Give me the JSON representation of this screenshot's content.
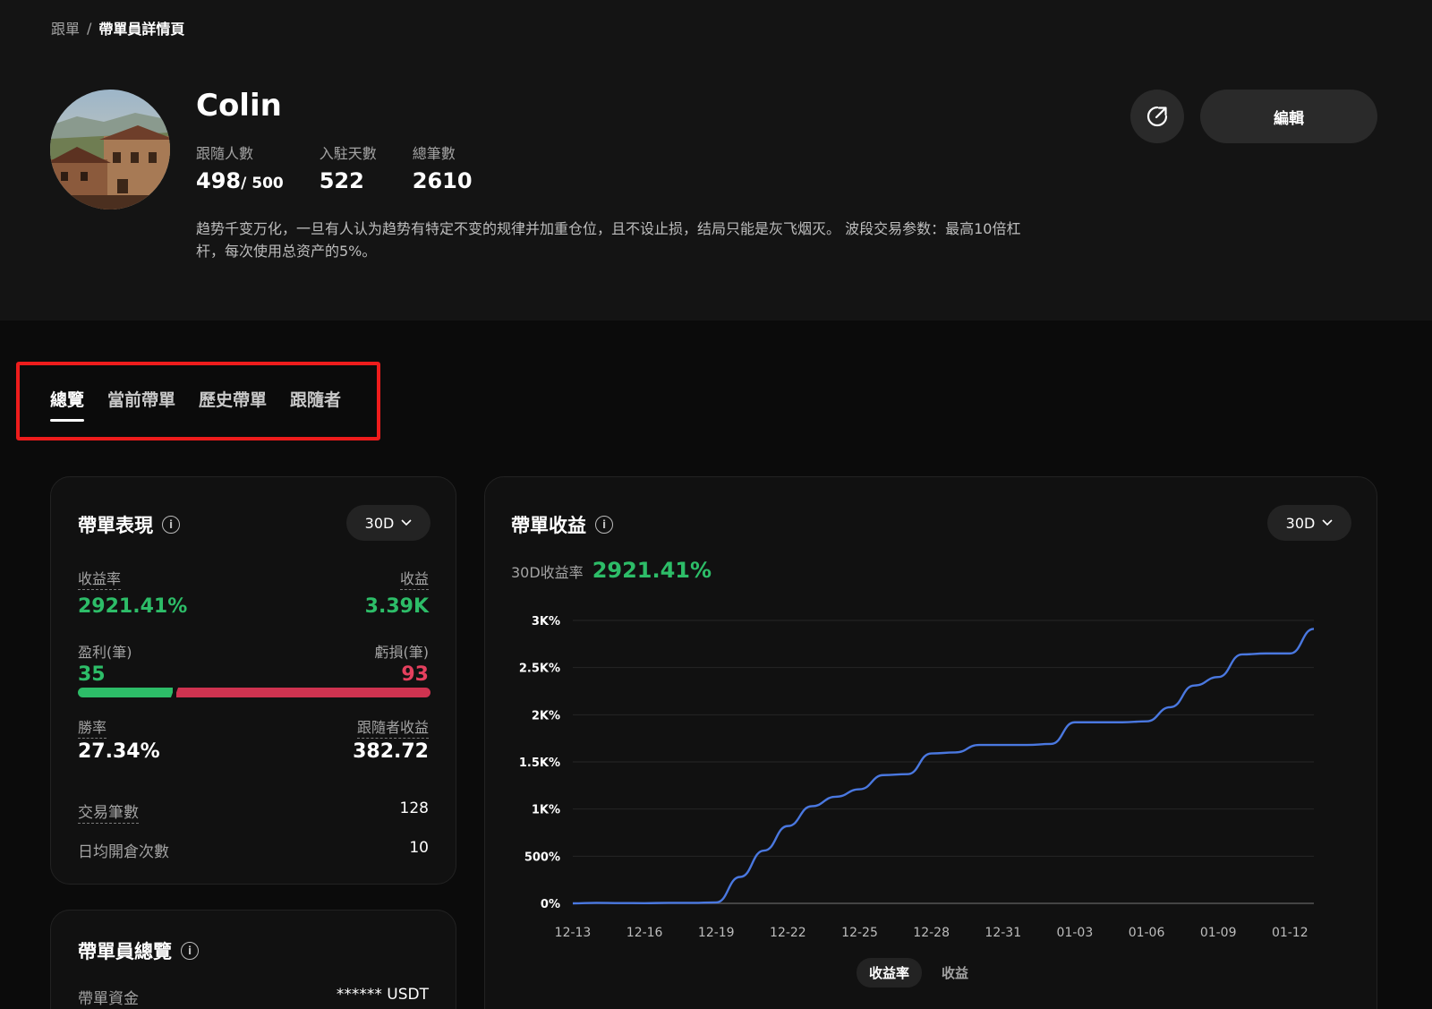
{
  "breadcrumb": {
    "root": "跟單",
    "separator": "/",
    "current": "帶單員詳情頁"
  },
  "profile": {
    "name": "Colin",
    "stats": [
      {
        "label": "跟隨人數",
        "value": "498",
        "suffix": "/ 500"
      },
      {
        "label": "入駐天數",
        "value": "522",
        "suffix": ""
      },
      {
        "label": "總筆數",
        "value": "2610",
        "suffix": ""
      }
    ],
    "bio": "趋势千变万化，一旦有人认为趋势有特定不变的规律并加重仓位，且不设止损，结局只能是灰飞烟灭。 波段交易参数：最高10倍杠杆，每次使用总资产的5%。",
    "edit_label": "編輯",
    "share_icon": "share-icon"
  },
  "tabs": [
    {
      "label": "總覽",
      "active": true
    },
    {
      "label": "當前帶單",
      "active": false
    },
    {
      "label": "歷史帶單",
      "active": false
    },
    {
      "label": "跟隨者",
      "active": false
    }
  ],
  "performance": {
    "title": "帶單表現",
    "period": "30D",
    "roi_label": "收益率",
    "roi_value": "2921.41%",
    "pnl_label": "收益",
    "pnl_value": "3.39K",
    "profit_count_label": "盈利(筆)",
    "profit_count": "35",
    "loss_count_label": "虧損(筆)",
    "loss_count": "93",
    "profit_share": 0.27,
    "winrate_label": "勝率",
    "winrate_value": "27.34%",
    "follower_pnl_label": "跟隨者收益",
    "follower_pnl_value": "382.72",
    "trades_label": "交易筆數",
    "trades_value": "128",
    "daily_open_label": "日均開倉次數",
    "daily_open_value": "10"
  },
  "overview": {
    "title": "帶單員總覽",
    "capital_label": "帶單資金",
    "capital_value": "****** USDT"
  },
  "earnings": {
    "title": "帶單收益",
    "period": "30D",
    "roi_label": "30D收益率",
    "roi_value": "2921.41%",
    "toggle": [
      {
        "label": "收益率",
        "active": true
      },
      {
        "label": "收益",
        "active": false
      }
    ]
  },
  "colors": {
    "green": "#2dbd68",
    "red": "#e5405e",
    "line": "#4a78e0",
    "highlight": "#ee1c1c"
  },
  "chart_data": {
    "type": "line",
    "title": "",
    "xlabel": "",
    "ylabel": "",
    "ylim": [
      0,
      3000
    ],
    "yticks": [
      {
        "value": 0,
        "label": "0%"
      },
      {
        "value": 500,
        "label": "500%"
      },
      {
        "value": 1000,
        "label": "1K%"
      },
      {
        "value": 1500,
        "label": "1.5K%"
      },
      {
        "value": 2000,
        "label": "2K%"
      },
      {
        "value": 2500,
        "label": "2.5K%"
      },
      {
        "value": 3000,
        "label": "3K%"
      }
    ],
    "xticks": [
      "12-13",
      "12-16",
      "12-19",
      "12-22",
      "12-25",
      "12-28",
      "12-31",
      "01-03",
      "01-06",
      "01-09",
      "01-12"
    ],
    "grid": true,
    "series": [
      {
        "x": [
          "12-13",
          "12-14",
          "12-15",
          "12-16",
          "12-17",
          "12-18",
          "12-19",
          "12-20",
          "12-21",
          "12-22",
          "12-23",
          "12-24",
          "12-25",
          "12-26",
          "12-27",
          "12-28",
          "12-29",
          "12-30",
          "12-31",
          "01-01",
          "01-02",
          "01-03",
          "01-04",
          "01-05",
          "01-06",
          "01-07",
          "01-08",
          "01-09",
          "01-10",
          "01-11",
          "01-12",
          "01-13"
        ],
        "y": [
          0,
          5,
          3,
          2,
          5,
          5,
          10,
          280,
          560,
          820,
          1030,
          1130,
          1210,
          1360,
          1370,
          1590,
          1600,
          1680,
          1680,
          1680,
          1690,
          1920,
          1920,
          1920,
          1930,
          2080,
          2310,
          2400,
          2640,
          2650,
          2650,
          2910
        ]
      }
    ]
  }
}
